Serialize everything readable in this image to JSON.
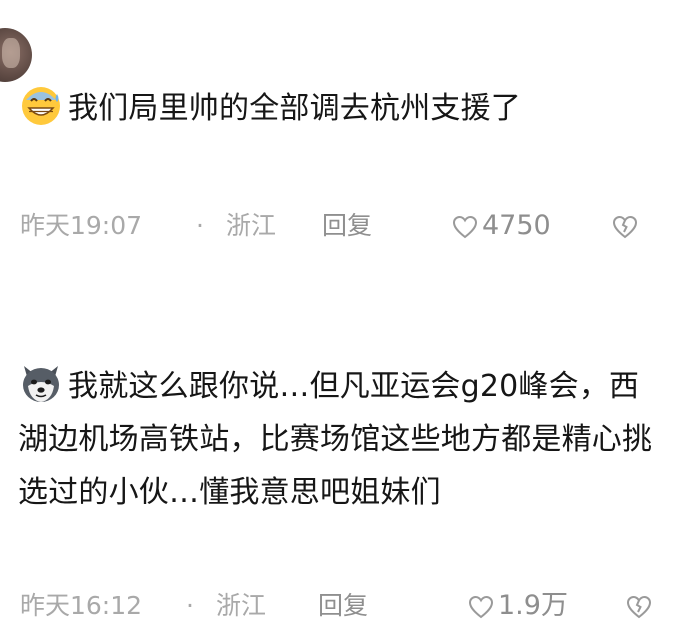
{
  "comments": [
    {
      "emoji": "grinning-sweat-emoji",
      "text": "我们局里帅的全部调去杭州支援了",
      "time": "昨天19:07",
      "separator": "·",
      "location": "浙江",
      "reply_label": "回复",
      "likes": "4750"
    },
    {
      "emoji": "dog-emoji",
      "text": "我就这么跟你说…但凡亚运会g20峰会，西湖边机场高铁站，比赛场馆这些地方都是精心挑选过的小伙…懂我意思吧姐妹们",
      "time": "昨天16:12",
      "separator": "·",
      "location": "浙江",
      "reply_label": "回复",
      "likes": "1.9万"
    }
  ],
  "colors": {
    "text": "#161616",
    "meta": "#a9a9a9",
    "icon": "#9a9a9a"
  },
  "icons": [
    "heart-outline-icon",
    "broken-heart-icon"
  ]
}
